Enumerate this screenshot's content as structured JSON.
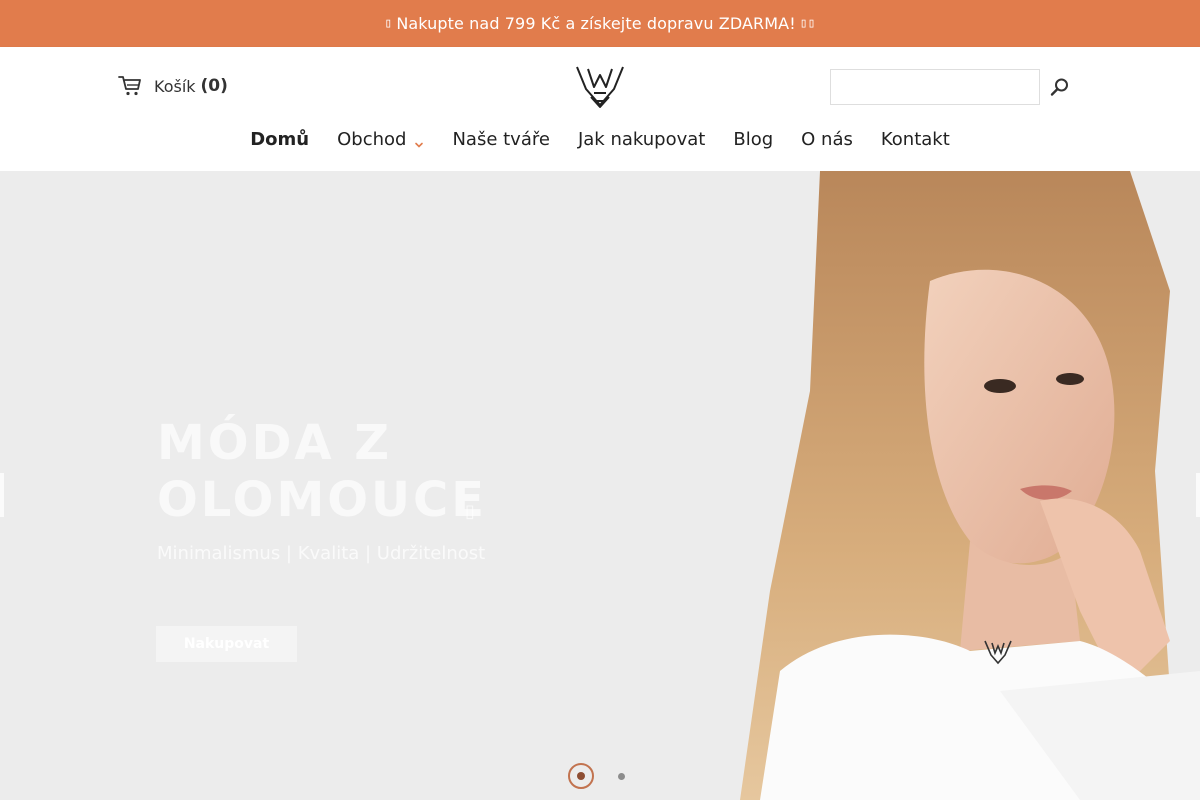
{
  "promo": {
    "lead_glyph": "▯",
    "text": "Nakupte nad 799 Kč a získejte dopravu ZDARMA!",
    "trail_glyph": "▯▯"
  },
  "header": {
    "cart_label": "Košík",
    "cart_count": "(0)",
    "search_placeholder": ""
  },
  "nav": {
    "items": [
      {
        "label": "Domů",
        "active": true
      },
      {
        "label": "Obchod",
        "dropdown": true
      },
      {
        "label": "Naše tváře"
      },
      {
        "label": "Jak nakupovat"
      },
      {
        "label": "Blog"
      },
      {
        "label": "O nás"
      },
      {
        "label": "Kontakt"
      }
    ]
  },
  "hero": {
    "title_line1": "MÓDA Z",
    "title_line2": "OLOMOUCE",
    "title_glyph": "▯",
    "subtitle": "Minimalismus | Kvalita | Udržitelnost",
    "cta_label": "Nakupovat",
    "slides_total": 2,
    "active_slide": 1
  },
  "colors": {
    "promo_bg": "#e17c4c",
    "hero_bg": "#ececec",
    "dot_active": "#c2734f"
  },
  "icons": {
    "cart": "cart-icon",
    "logo": "brand-logo",
    "search": "search-icon",
    "caret": "chevron-down-icon"
  }
}
